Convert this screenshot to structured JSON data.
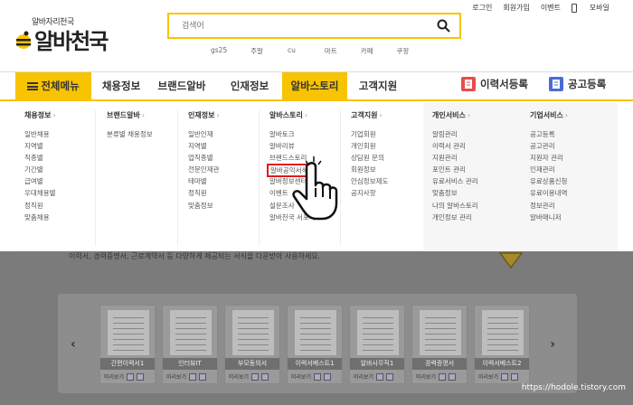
{
  "header": {
    "logo_sub": "알바자리천국",
    "logo": "알바천국",
    "search_placeholder": "검색어",
    "keywords": [
      "gs25",
      "주말",
      "cu",
      "마트",
      "카페",
      "쿠팡"
    ],
    "top_links": [
      "로그인",
      "회원가입",
      "이벤트",
      "모바일"
    ]
  },
  "nav": {
    "all_menu": "전체메뉴",
    "items": [
      "채용정보",
      "브랜드알바",
      "인재정보",
      "알바스토리",
      "고객지원"
    ],
    "active": "알바스토리",
    "resume_btn": "이력서등록",
    "post_btn": "공고등록"
  },
  "mega_menu": {
    "columns": [
      {
        "title": "채용정보",
        "items": [
          "일반채용",
          "지역별",
          "직종별",
          "기간별",
          "급여별",
          "우대채용별",
          "정직원",
          "맞춤채용"
        ]
      },
      {
        "title": "브랜드알바",
        "items": [
          "분류별 채용정보"
        ]
      },
      {
        "title": "인재정보",
        "items": [
          "일반인재",
          "지역별",
          "업직종별",
          "전문인재관",
          "테마별",
          "정직원",
          "맞춤정보"
        ]
      },
      {
        "title": "알바스토리",
        "items": [
          "알바토크",
          "알바리뷰",
          "브랜드스토리",
          "알바공익서식",
          "알바정보센터",
          "이벤트",
          "설문조사",
          "알바천국 서포터즈"
        ]
      },
      {
        "title": "고객지원",
        "items": [
          "기업회원",
          "개인회원",
          "상담원 문의",
          "회원정보",
          "안심정보제도",
          "공지사항"
        ]
      },
      {
        "title": "개인서비스",
        "items": [
          "알림관리",
          "이력서 관리",
          "지원관리",
          "포인트 관리",
          "유료서비스 관리",
          "맞춤정보",
          "나의 알바스토리",
          "개인정보 관리"
        ]
      },
      {
        "title": "기업서비스",
        "items": [
          "공고등록",
          "공고관리",
          "지원자 관리",
          "인재관리",
          "유료상품신청",
          "유료이용내역",
          "정보관리",
          "알바매니저"
        ]
      }
    ]
  },
  "content": {
    "description": "이력서, 경력증명서, 근로계약서 등 다양하게 제공되는 서식을 다운받아 사용하세요.",
    "cards": [
      {
        "label": "간편이력서1",
        "preview": "미리보기"
      },
      {
        "label": "인터뷰IT",
        "preview": "미리보기"
      },
      {
        "label": "부모동의서",
        "preview": "미리보기"
      },
      {
        "label": "이력서베스트1",
        "preview": "미리보기"
      },
      {
        "label": "알바사무직1",
        "preview": "미리보기"
      },
      {
        "label": "경력증명서",
        "preview": "미리보기"
      },
      {
        "label": "이력서베스트2",
        "preview": "미리보기"
      }
    ]
  },
  "watermark": "https://hodole.tistory.com",
  "colors": {
    "brand_yellow": "#f8c300",
    "highlight_red": "#e01b1b",
    "dim_gray": "#7b7b7b"
  }
}
